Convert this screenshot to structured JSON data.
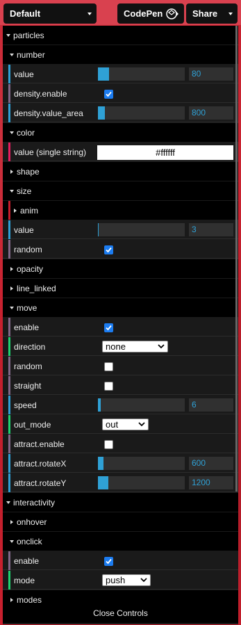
{
  "header": {
    "preset_label": "Default",
    "codepen_label": "CodePen",
    "share_label": "Share"
  },
  "colors": {
    "accent_blue": "#2fa1d6",
    "stripe_number": "#2fa1d6",
    "stripe_boolean": "#806787",
    "stripe_string": "#1ed36f",
    "stripe_color": "#e61d5f",
    "page_bg": "#c8202e"
  },
  "gui": {
    "particles": "particles",
    "number": "number",
    "number_value_label": "value",
    "number_value": "80",
    "density_enable_label": "density.enable",
    "density_area_label": "density.value_area",
    "density_area": "800",
    "color": "color",
    "color_value_label": "value (single string)",
    "color_value": "#ffffff",
    "shape": "shape",
    "size": "size",
    "anim": "anim",
    "size_value_label": "value",
    "size_value": "3",
    "size_random_label": "random",
    "opacity": "opacity",
    "line_linked": "line_linked",
    "move": "move",
    "move_enable_label": "enable",
    "direction_label": "direction",
    "direction_value": "none",
    "move_random_label": "random",
    "straight_label": "straight",
    "speed_label": "speed",
    "speed_value": "6",
    "out_mode_label": "out_mode",
    "out_mode_value": "out",
    "attract_enable_label": "attract.enable",
    "rotateX_label": "attract.rotateX",
    "rotateX_value": "600",
    "rotateY_label": "attract.rotateY",
    "rotateY_value": "1200",
    "interactivity": "interactivity",
    "onhover": "onhover",
    "onclick": "onclick",
    "onclick_enable_label": "enable",
    "mode_label": "mode",
    "mode_value": "push",
    "modes": "modes",
    "close_label": "Close Controls"
  },
  "slider_levels": {
    "number_value": 0.13,
    "density_area": 0.08,
    "size_value": 0.01,
    "speed": 0.03,
    "rotateX": 0.06,
    "rotateY": 0.12
  },
  "checkbox_states": {
    "density_enable": true,
    "size_random": true,
    "move_enable": true,
    "move_random": false,
    "straight": false,
    "attract_enable": false,
    "onclick_enable": true
  }
}
